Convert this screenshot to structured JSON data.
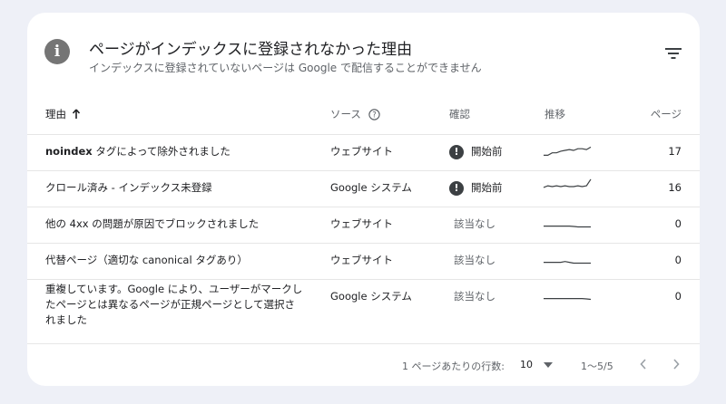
{
  "header": {
    "title": "ページがインデックスに登録されなかった理由",
    "subtitle": "インデックスに登録されていないページは Google で配信することができません"
  },
  "columns": {
    "reason": "理由",
    "source": "ソース",
    "status": "確認",
    "trend": "推移",
    "pages": "ページ"
  },
  "rows": [
    {
      "reason_bold": "noindex",
      "reason": " タグによって除外されました",
      "source": "ウェブサイト",
      "status": "開始前",
      "status_type": "warning",
      "trend": [
        0.2,
        0.2,
        0.35,
        0.35,
        0.45,
        0.5,
        0.55,
        0.5,
        0.6,
        0.6,
        0.55,
        0.7
      ],
      "pages": "17"
    },
    {
      "reason_bold": "",
      "reason": "クロール済み - インデックス未登録",
      "source": "Google システム",
      "status": "開始前",
      "status_type": "warning",
      "trend": [
        0.45,
        0.55,
        0.5,
        0.55,
        0.5,
        0.55,
        0.5,
        0.5,
        0.55,
        0.5,
        0.55,
        0.95
      ],
      "pages": "16"
    },
    {
      "reason_bold": "",
      "reason": "他の 4xx の問題が原因でブロックされました",
      "source": "ウェブサイト",
      "status": "該当なし",
      "status_type": "none",
      "trend": [
        0.3,
        0.3,
        0.3,
        0.3,
        0.3,
        0.3,
        0.3,
        0.28,
        0.25,
        0.25,
        0.25,
        0.25
      ],
      "pages": "0"
    },
    {
      "reason_bold": "",
      "reason": "代替ページ（適切な canonical タグあり）",
      "source": "ウェブサイト",
      "status": "該当なし",
      "status_type": "none",
      "trend": [
        0.3,
        0.3,
        0.3,
        0.3,
        0.3,
        0.35,
        0.3,
        0.25,
        0.25,
        0.25,
        0.25,
        0.25
      ],
      "pages": "0"
    },
    {
      "reason_bold": "",
      "reason": "重複しています。Google により、ユーザーがマークしたページとは異なるページが正規ページとして選択されました",
      "source": "Google システム",
      "status": "該当なし",
      "status_type": "none",
      "trend": [
        0.3,
        0.3,
        0.3,
        0.3,
        0.3,
        0.3,
        0.3,
        0.3,
        0.3,
        0.3,
        0.28,
        0.25
      ],
      "pages": "0"
    }
  ],
  "footer": {
    "rows_per_page_label": "1 ページあたりの行数:",
    "rows_per_page_value": "10",
    "range": "1～5/5"
  },
  "colors": {
    "text": "#202124",
    "secondary": "#5f6368",
    "sparkline": "#3c4043",
    "background": "#eef0f7"
  },
  "icons": [
    "info-icon",
    "filter-icon",
    "sort-arrow-up-icon",
    "help-circle-icon",
    "warning-icon",
    "chevron-down-icon",
    "chevron-left-icon",
    "chevron-right-icon"
  ]
}
